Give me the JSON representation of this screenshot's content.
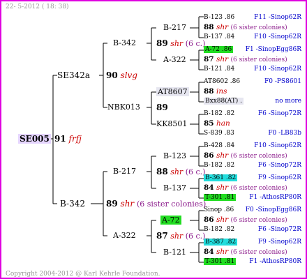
{
  "header": {
    "date": "22-  5-2012 ( 18: 38)"
  },
  "footer": {
    "copyright": "Copyright 2004-2012 @ Karl Kehrle Foundation."
  },
  "root": {
    "id": "SE005",
    "gen": "91",
    "breeder": "frfj"
  },
  "dam": {
    "id": "SE342a",
    "mother": {
      "id": "B-342",
      "gen": "90",
      "breeder": "slvg"
    },
    "father": {
      "id": "NBK013"
    }
  },
  "sire": {
    "id": "B-342",
    "gen": "89",
    "breeder": "shr",
    "note": "(6 sister colonies)",
    "mother": {
      "id": "B-217"
    },
    "father": {
      "id": "A-322"
    }
  },
  "g3": [
    {
      "id": "B-217"
    },
    {
      "id": "A-322"
    },
    {
      "id": "AT8607"
    },
    {
      "id": "KK8501"
    },
    {
      "id": "B-123"
    },
    {
      "id": "B-137"
    },
    {
      "id": "A-72"
    },
    {
      "id": "B-121"
    }
  ],
  "g3info": [
    {
      "gen": "89",
      "breeder": "shr",
      "note": "(6 c.)"
    },
    {
      "gen": "89"
    },
    {
      "gen": "88",
      "breeder": "shr",
      "note": "(6 c.)"
    },
    {
      "gen": "87",
      "breeder": "shr",
      "note": "(6 c.)"
    }
  ],
  "g4": [
    {
      "top": "B-123 .86",
      "mid_gen": "88",
      "mid_breeder": "shr",
      "mid_note": "(6 sister colonies)",
      "bot": "B-137 .84",
      "top_right": "F11 -Sinop62R",
      "bot_right": "F10 -Sinop62R"
    },
    {
      "top": "A-72 .86",
      "mid_gen": "87",
      "mid_breeder": "shr",
      "mid_note": "(6 sister colonies)",
      "bot": "B-121 .84",
      "top_right": "F1 -SinopEgg86R",
      "bot_right": "F10 -Sinop62R"
    },
    {
      "top": "AT8602 .86",
      "mid_gen": "88",
      "mid_breeder": "ins",
      "mid_note": "",
      "bot": "Bxx88(AT) .",
      "top_right": "F0 -PS8601",
      "bot_right": "no more"
    },
    {
      "top": "B-182 .82",
      "mid_gen": "85",
      "mid_breeder": "han",
      "mid_note": "",
      "bot": "S-839 .83",
      "top_right": "F6 -Sinop72R",
      "bot_right": "F0 -LB83b"
    },
    {
      "top": "B-428 .84",
      "mid_gen": "86",
      "mid_breeder": "shr",
      "mid_note": "(6 sister colonies)",
      "bot": "B-182 .82",
      "top_right": "F10 -Sinop62R",
      "bot_right": "F6 -Sinop72R"
    },
    {
      "top": "B-361 .82",
      "mid_gen": "84",
      "mid_breeder": "shr",
      "mid_note": "(6 sister colonies)",
      "bot": "T-301 .81",
      "top_right": "F9 -Sinop62R",
      "bot_right": "F1 -AthosRP80R"
    },
    {
      "top": "Sinop .86",
      "mid_gen": "86",
      "mid_breeder": "shr",
      "mid_note": "(6 sister colonies)",
      "bot": "B-182 .82",
      "top_right": "F0 -SinopEgg86R",
      "bot_right": "F6 -Sinop72R"
    },
    {
      "top": "B-387 .82",
      "mid_gen": "84",
      "mid_breeder": "shr",
      "mid_note": "(6 sister colonies)",
      "bot": "T-301 .81",
      "top_right": "F9 -Sinop62R",
      "bot_right": "F1 -AthosRP80R"
    }
  ],
  "colors": {
    "border": "#e000e0",
    "root_bg": "#e6d6ff",
    "green": "#22dd22",
    "cyan": "#22dddd"
  }
}
